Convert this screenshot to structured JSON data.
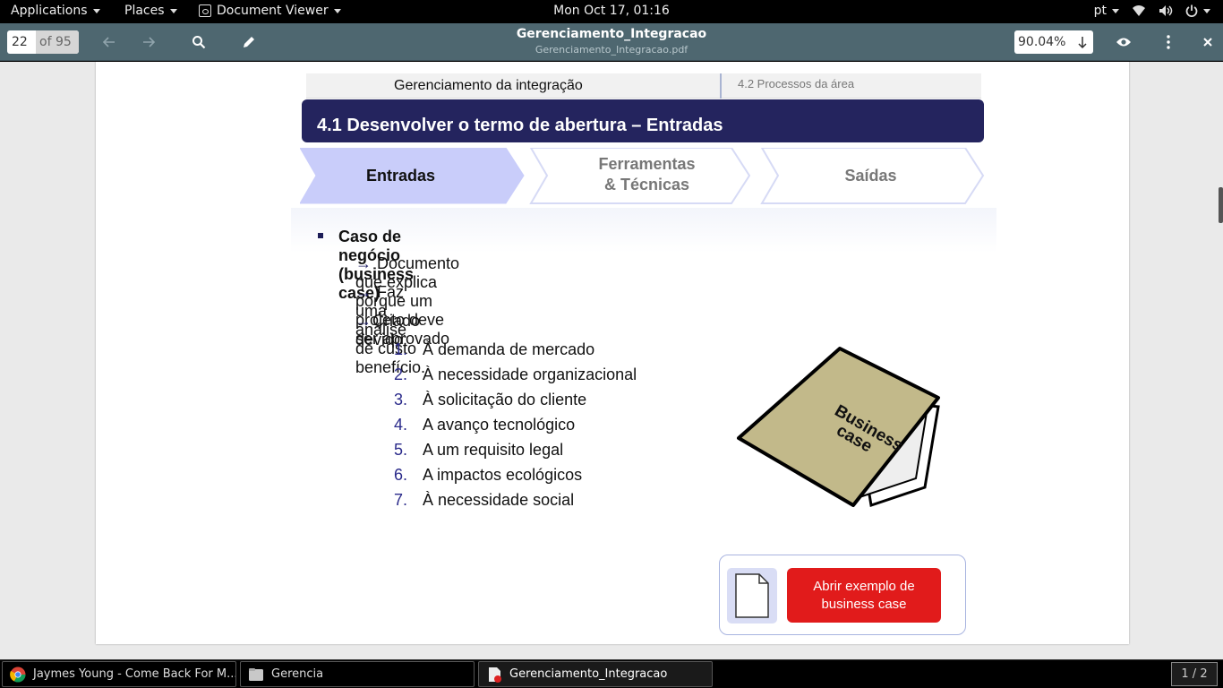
{
  "topbar": {
    "applications": "Applications",
    "places": "Places",
    "app_menu": "Document Viewer",
    "clock": "Mon Oct 17, 01:16",
    "language": "pt"
  },
  "viewer": {
    "page_current": "22",
    "page_total": "of 95",
    "title": "Gerenciamento_Integracao",
    "subtitle": "Gerenciamento_Integracao.pdf",
    "zoom": "90.04%"
  },
  "slide": {
    "header_left": "Gerenciamento da integração",
    "header_right": "4.2 Processos da área",
    "band_title": "4.1 Desenvolver o termo de abertura – Entradas",
    "steps": [
      "Entradas",
      "Ferramentas",
      "& Técnicas",
      "Saídas"
    ],
    "bullet_title": "Caso de negócio (business case)",
    "arrow_items": [
      "Documento que explica porque um projeto deve ser aprovado",
      "Faz uma análise de custo benefício.",
      "Criado devido:"
    ],
    "list_numbers": [
      "1.",
      "2.",
      "3.",
      "4.",
      "5.",
      "6.",
      "7."
    ],
    "list_items": [
      "À demanda de mercado",
      "À necessidade organizacional",
      "À solicitação do cliente",
      "A avanço tecnológico",
      "A um requisito legal",
      "A impactos ecológicos",
      "À necessidade social"
    ],
    "folder_label_1": "Business",
    "folder_label_2": "case",
    "open_button_line1": "Abrir exemplo de",
    "open_button_line2": "business case"
  },
  "taskbar": {
    "tasks": [
      "Jaymes Young - Come Back For M...",
      "Gerencia",
      "Gerenciamento_Integracao"
    ],
    "workspace": "1 / 2"
  },
  "colors": {
    "headerbar": "#4e6770",
    "band": "#24245e",
    "step_active": "#c9cdfa",
    "button_red": "#e11b1b"
  }
}
